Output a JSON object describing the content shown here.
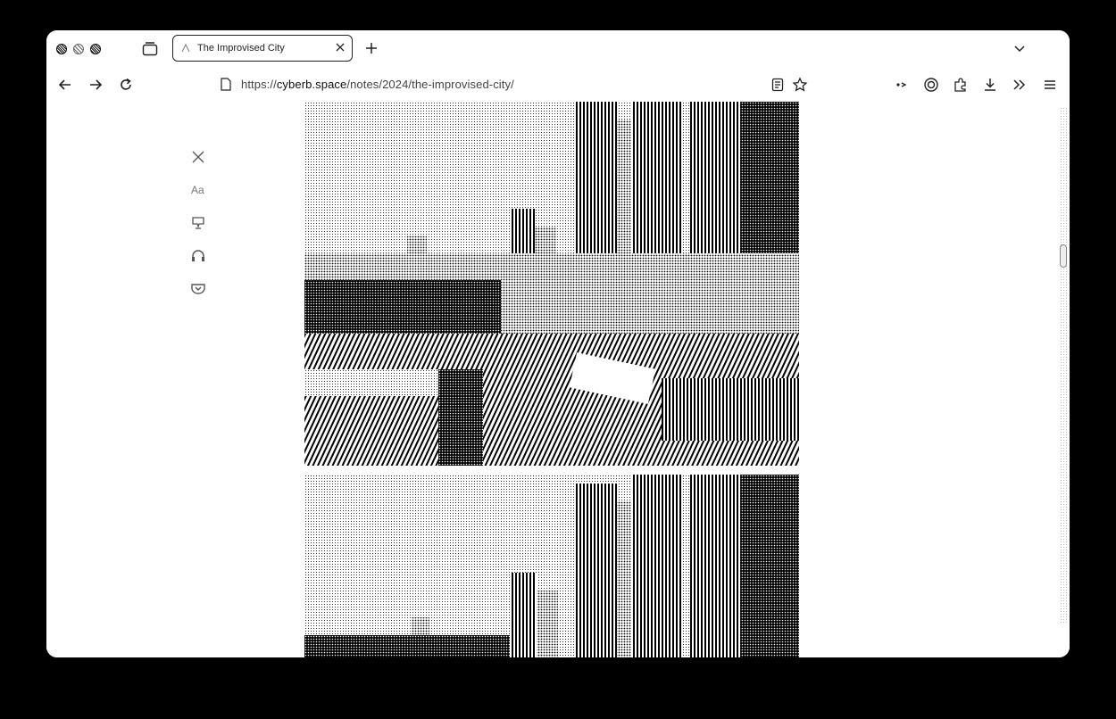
{
  "browser": {
    "tab": {
      "title": "The Improvised City"
    },
    "url": {
      "scheme": "https://",
      "host": "cyberb.space",
      "path": "/notes/2024/the-improvised-city/"
    },
    "toolbar_buttons": [
      "back-icon",
      "forward-icon",
      "reload-icon",
      "reader-mode-icon",
      "bookmark-star-icon",
      "extension-icon",
      "shield-icon",
      "puzzle-icon",
      "download-icon",
      "overflow-icon",
      "menu-icon"
    ]
  },
  "reader_sidebar": {
    "items": [
      "close-icon",
      "text-settings-icon",
      "narrate-icon",
      "audio-icon",
      "pocket-icon"
    ],
    "aa_label": "Aa"
  },
  "article": {
    "images": [
      "city-photo-1",
      "city-photo-2"
    ]
  }
}
